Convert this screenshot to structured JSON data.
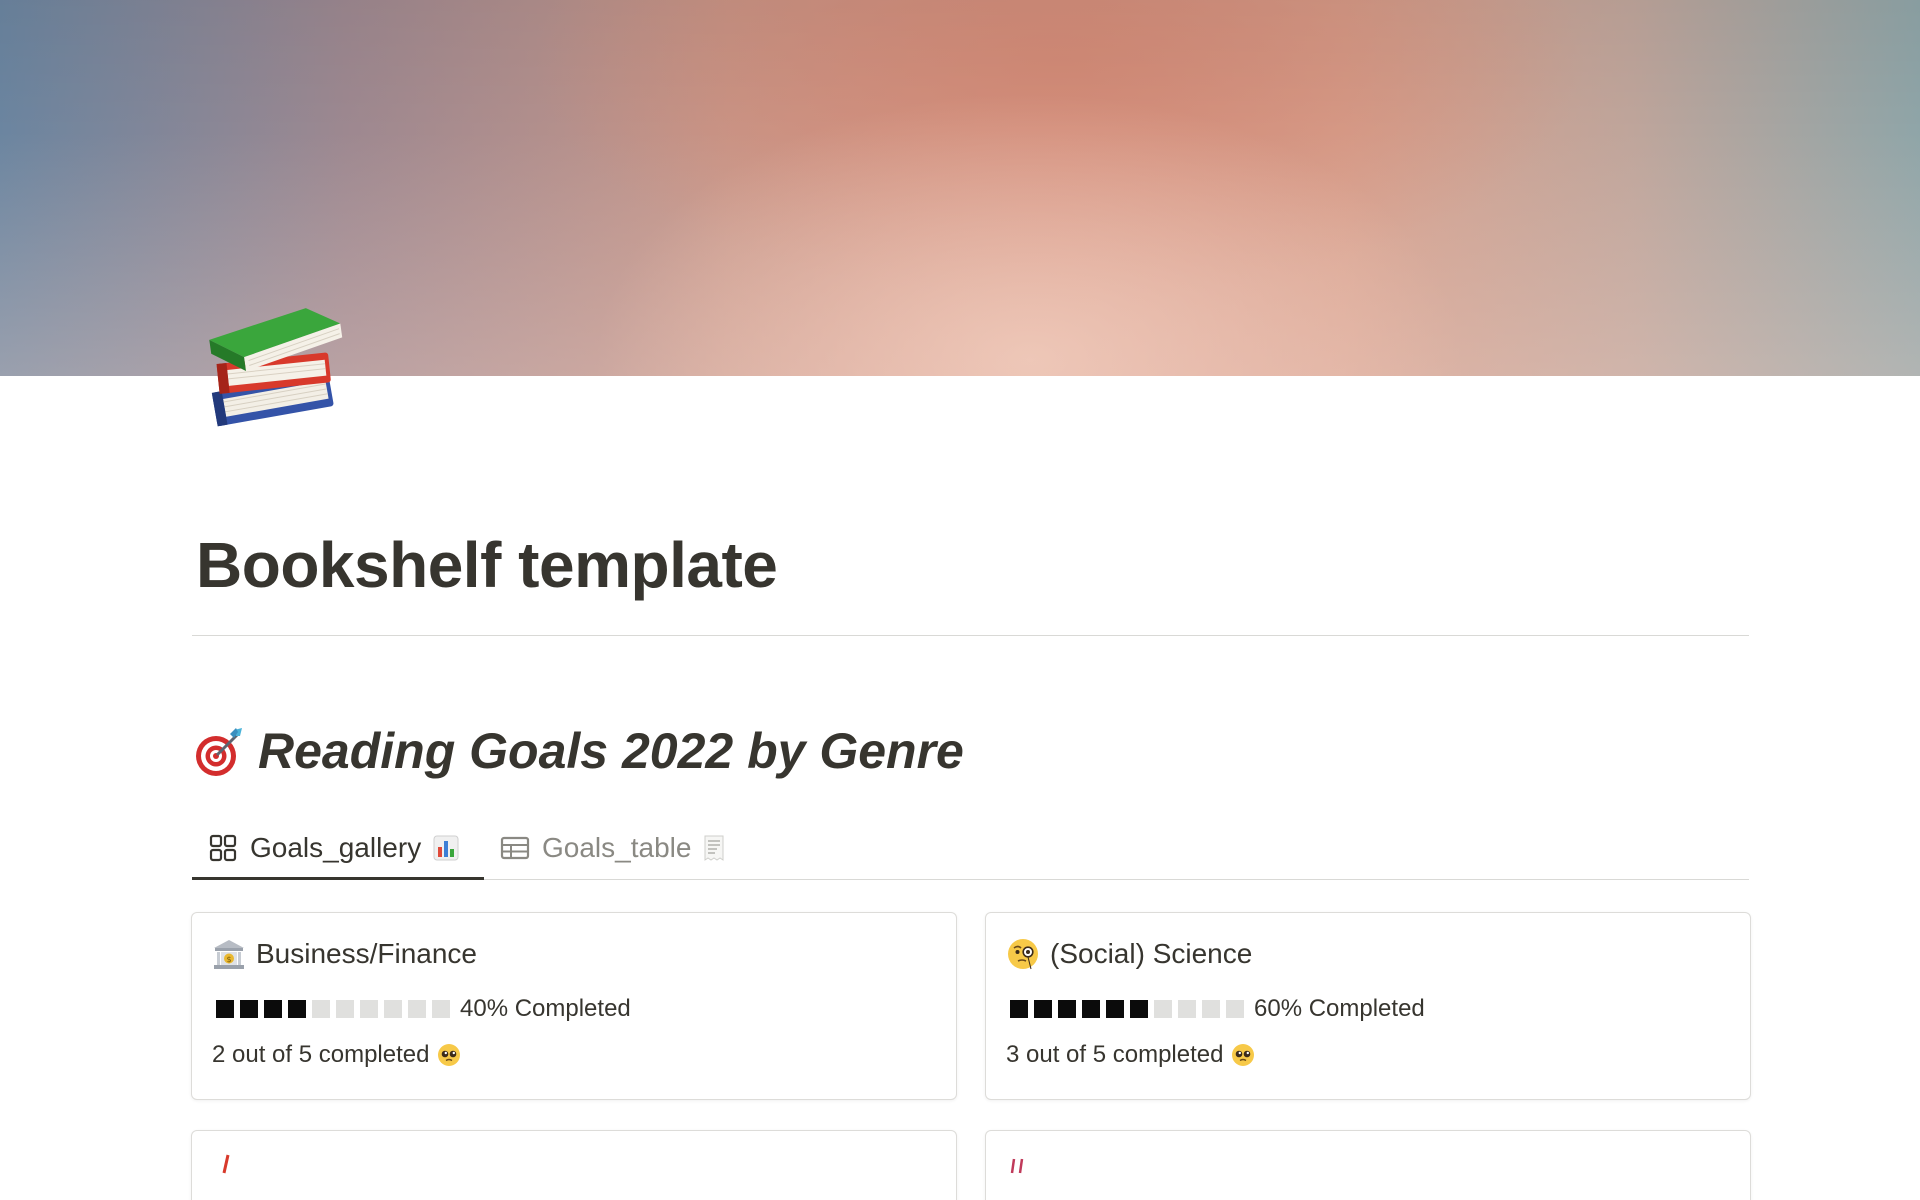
{
  "page": {
    "title": "Bookshelf template",
    "icon": "books-icon"
  },
  "section": {
    "heading": "Reading Goals 2022 by Genre",
    "icon": "target-icon"
  },
  "tabs": [
    {
      "label": "Goals_gallery",
      "icon": "gallery-icon",
      "suffix_icon": "bar-chart-icon",
      "active": true
    },
    {
      "label": "Goals_table",
      "icon": "table-icon",
      "suffix_icon": "receipt-icon",
      "active": false
    }
  ],
  "cards": [
    {
      "icon": "bank-icon",
      "title": "Business/Finance",
      "progress": 0.4,
      "progress_label": "40% Completed",
      "count_label": "2 out of 5 completed",
      "count_icon": "pleading-face-icon"
    },
    {
      "icon": "face-with-monocle-icon",
      "title": "(Social) Science",
      "progress": 0.6,
      "progress_label": "60% Completed",
      "count_label": "3 out of 5 completed",
      "count_icon": "pleading-face-icon"
    }
  ],
  "colors": {
    "text": "#37352f",
    "muted": "#8a8983",
    "progress_on": "#0b0b0b",
    "progress_off": "#e0e0de"
  }
}
